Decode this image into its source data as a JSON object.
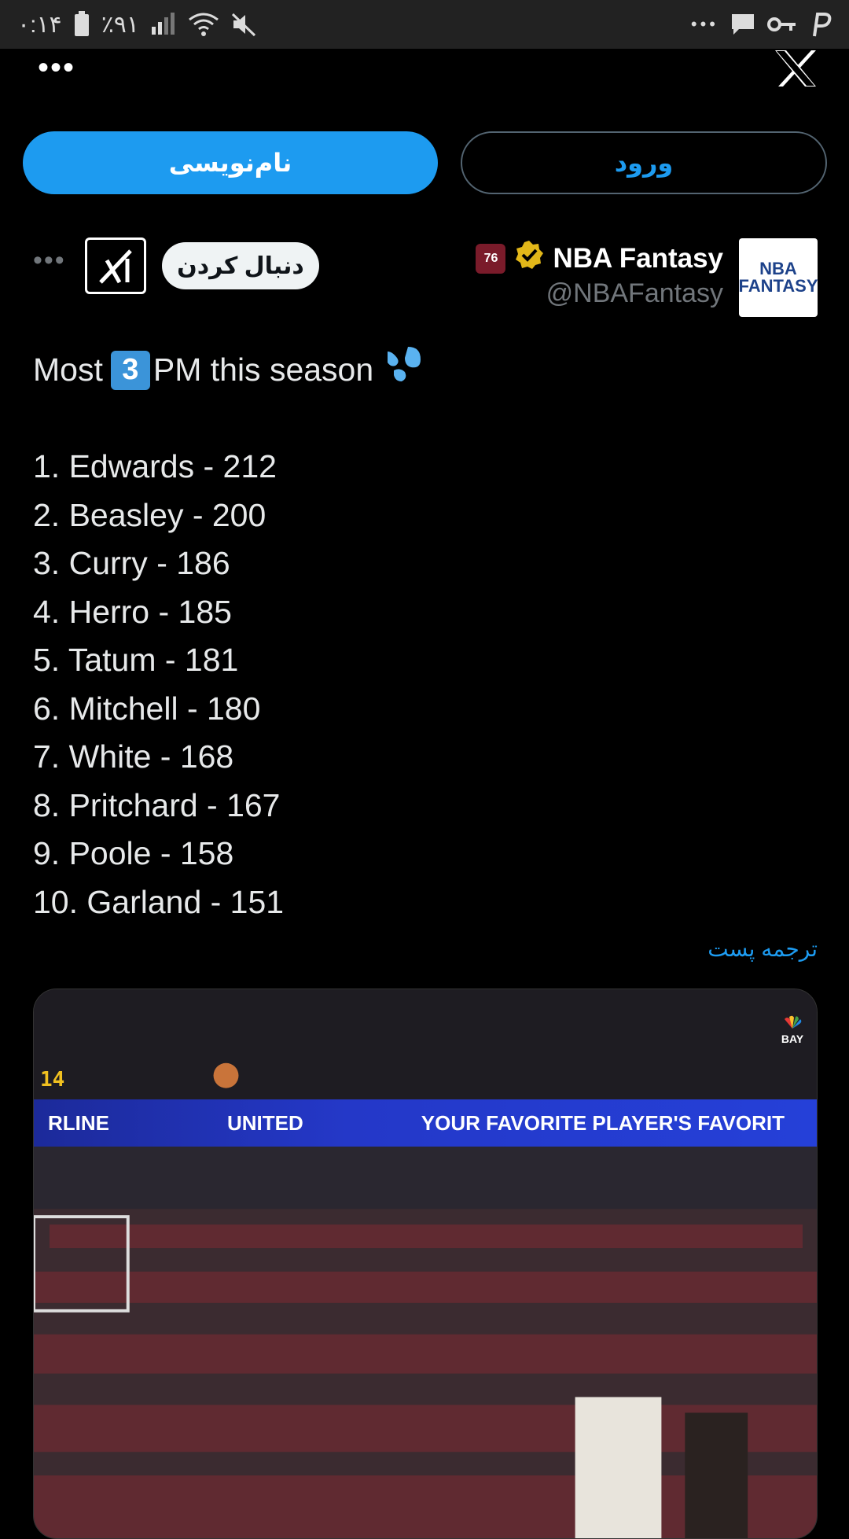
{
  "status_bar": {
    "time": "۰:۱۴",
    "battery": "٪۹۱",
    "overflow": "•••"
  },
  "top": {
    "more_label": "•••",
    "logo_icon": "x-logo-icon"
  },
  "actions": {
    "signup_label": "نام‌نویسی",
    "login_label": "ورود"
  },
  "author": {
    "display_name": "NBA Fantasy",
    "handle": "@NBAFantasy",
    "avatar_line1": "NBA",
    "avatar_line2": "FANTASY",
    "team_badge": "76",
    "follow_label": "دنبال کردن",
    "more_label": "•••"
  },
  "tweet": {
    "title_before": "Most",
    "title_key": "3",
    "title_after": "PM this season",
    "lines": [
      "1. Edwards - 212",
      "2. Beasley - 200",
      "3. Curry - 186",
      "4. Herro - 185",
      "5. Tatum - 181",
      "6. Mitchell - 180",
      "7. White - 168",
      "8. Pritchard - 167",
      "9. Poole - 158",
      "10. Garland - 151"
    ],
    "translate_label": "ترجمه پست"
  },
  "media": {
    "board_texts": [
      "RLINE",
      "UNITED",
      "YOUR FAVORITE PLAYER'S FAVORIT"
    ],
    "clock": "14",
    "network": "BAY"
  },
  "colors": {
    "accent": "#1d9bf0",
    "background": "#000000",
    "status_bar": "#222222"
  }
}
